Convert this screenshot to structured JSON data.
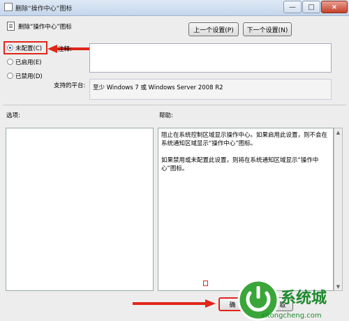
{
  "window": {
    "title": "删除“操作中心”图标",
    "minimize": "—",
    "maximize": "□",
    "close": "×"
  },
  "header": {
    "title": "删除“操作中心”图标"
  },
  "nav": {
    "prev": "上一个设置(P)",
    "next": "下一个设置(N)"
  },
  "radios": [
    {
      "label": "未配置(C)",
      "selected": true
    },
    {
      "label": "已启用(E)",
      "selected": false
    },
    {
      "label": "已禁用(D)",
      "selected": false
    }
  ],
  "comment": {
    "label": "注释:",
    "value": ""
  },
  "platform": {
    "label": "支持的平台:",
    "value": "至少 Windows 7 或 Windows Server 2008 R2"
  },
  "options": {
    "label": "选项:"
  },
  "help": {
    "label": "帮助:",
    "p1": "阻止在系统控制区域显示操作中心。如果启用此设置，则不会在系统通知区域显示“操作中心”图标。",
    "p2": "如果禁用或未配置此设置，则将在系统通知区域显示“操作中心”图标。"
  },
  "buttons": {
    "ok": "确",
    "cancel": "取"
  },
  "watermark": {
    "text": "系统城",
    "domain": "xitongcheng.com"
  },
  "colors": {
    "highlight": "#e0261a",
    "arrow": "#e0261a"
  }
}
